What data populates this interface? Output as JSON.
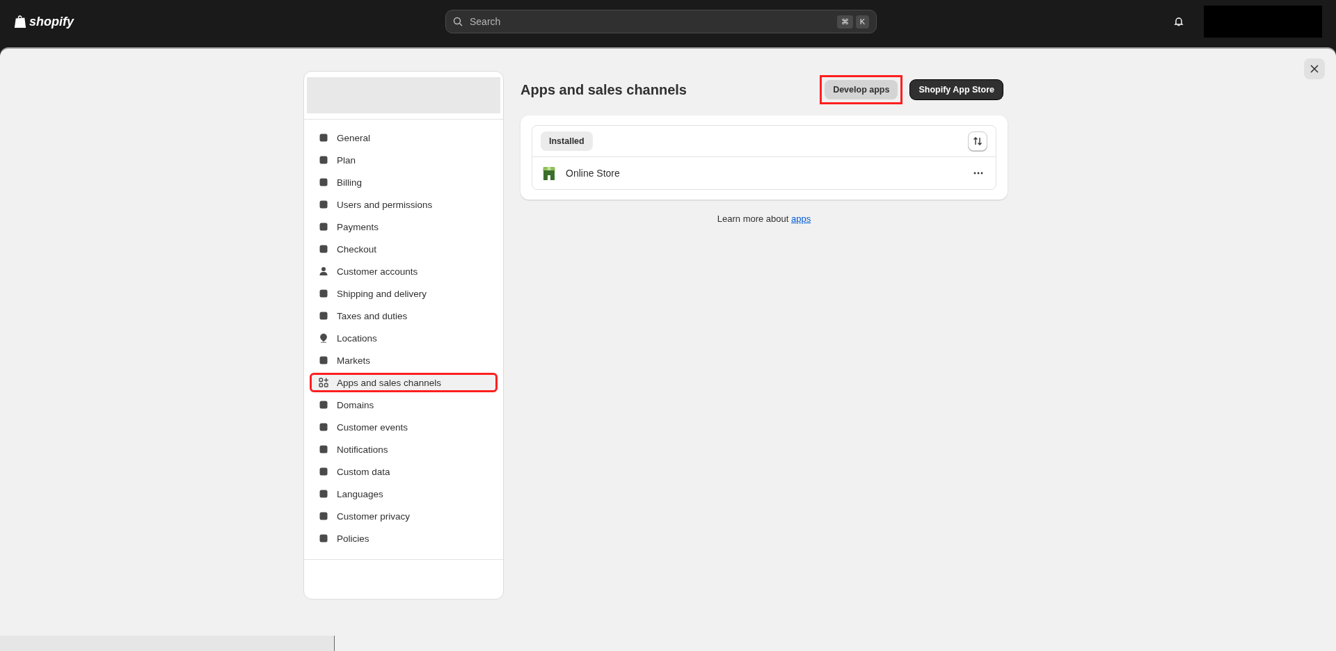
{
  "topbar": {
    "logo": "shopify",
    "search": {
      "placeholder": "Search",
      "shortcut": [
        "⌘",
        "K"
      ]
    }
  },
  "sidebar": {
    "items": [
      {
        "label": "General",
        "selected": false,
        "highlighted": false
      },
      {
        "label": "Plan",
        "selected": false,
        "highlighted": false
      },
      {
        "label": "Billing",
        "selected": false,
        "highlighted": false
      },
      {
        "label": "Users and permissions",
        "selected": false,
        "highlighted": false
      },
      {
        "label": "Payments",
        "selected": false,
        "highlighted": false
      },
      {
        "label": "Checkout",
        "selected": false,
        "highlighted": false
      },
      {
        "label": "Customer accounts",
        "selected": false,
        "highlighted": false
      },
      {
        "label": "Shipping and delivery",
        "selected": false,
        "highlighted": false
      },
      {
        "label": "Taxes and duties",
        "selected": false,
        "highlighted": false
      },
      {
        "label": "Locations",
        "selected": false,
        "highlighted": false
      },
      {
        "label": "Markets",
        "selected": false,
        "highlighted": false
      },
      {
        "label": "Apps and sales channels",
        "selected": true,
        "highlighted": true
      },
      {
        "label": "Domains",
        "selected": false,
        "highlighted": false
      },
      {
        "label": "Customer events",
        "selected": false,
        "highlighted": false
      },
      {
        "label": "Notifications",
        "selected": false,
        "highlighted": false
      },
      {
        "label": "Custom data",
        "selected": false,
        "highlighted": false
      },
      {
        "label": "Languages",
        "selected": false,
        "highlighted": false
      },
      {
        "label": "Customer privacy",
        "selected": false,
        "highlighted": false
      },
      {
        "label": "Policies",
        "selected": false,
        "highlighted": false
      }
    ]
  },
  "main": {
    "title": "Apps and sales channels",
    "buttons": [
      {
        "label": "Develop apps",
        "kind": "secondary",
        "highlighted": true
      },
      {
        "label": "Shopify App Store",
        "kind": "primary",
        "highlighted": false
      }
    ],
    "tabs": [
      {
        "label": "Installed",
        "selected": true
      }
    ],
    "apps": [
      {
        "name": "Online Store"
      }
    ],
    "footer": {
      "text": "Learn more about ",
      "link": "apps"
    }
  }
}
